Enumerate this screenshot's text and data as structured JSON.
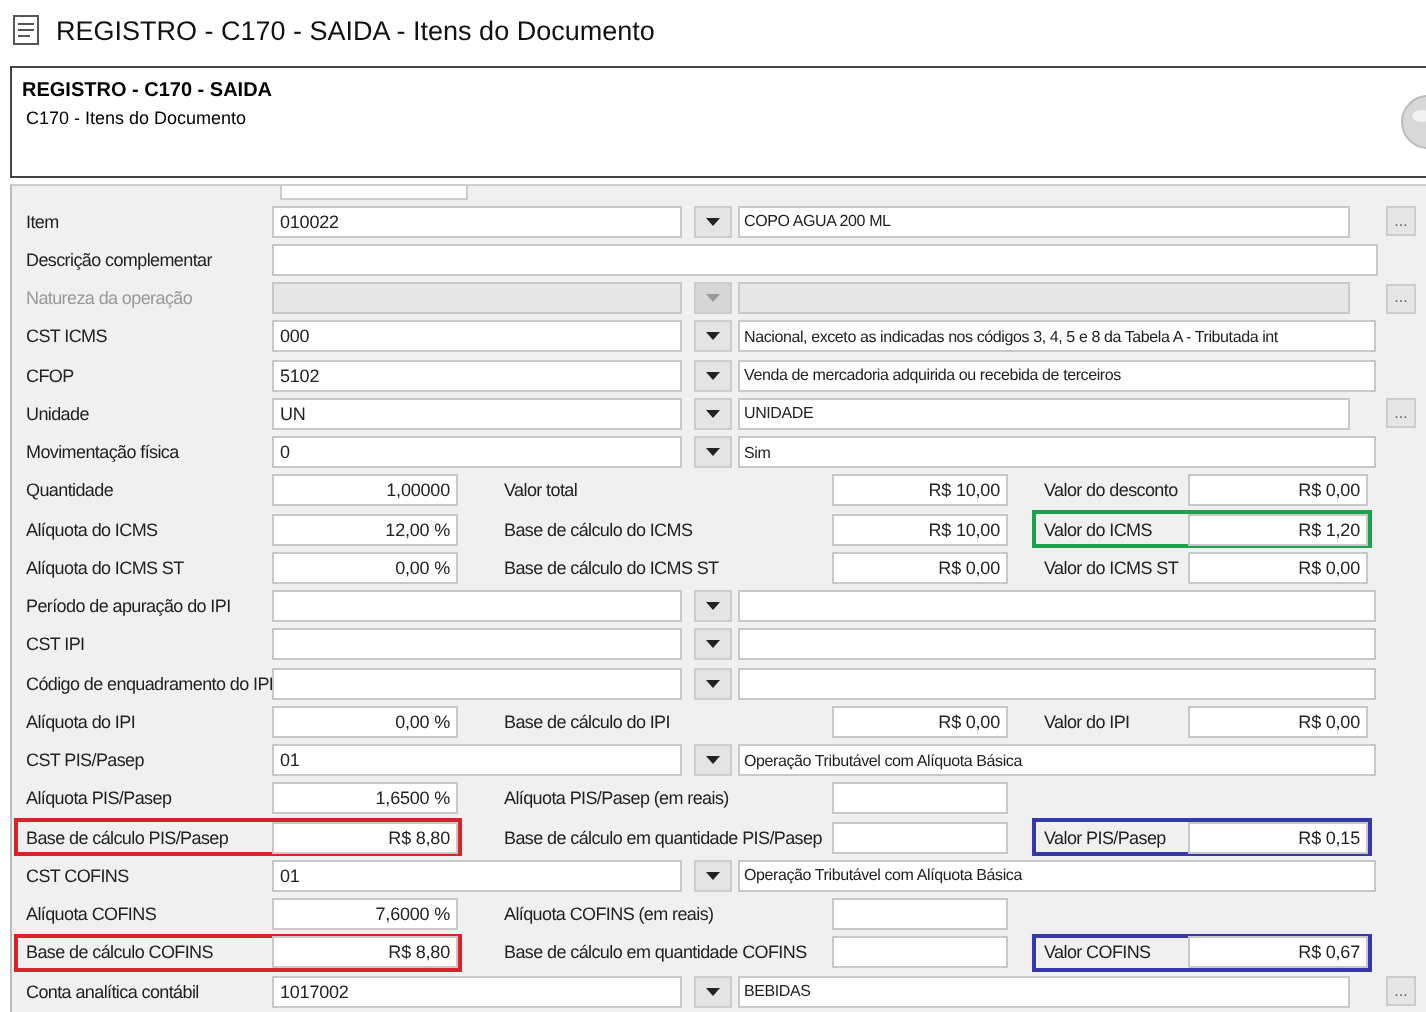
{
  "window": {
    "title": "REGISTRO - C170 - SAIDA - Itens do Documento"
  },
  "header": {
    "title": "REGISTRO - C170 - SAIDA",
    "subtitle": "C170 - Itens do Documento"
  },
  "form": {
    "rows": [
      {
        "kind": "lookup",
        "label": "Item",
        "code": "010022",
        "description": "COPO AGUA 200 ML",
        "more_button": "...",
        "disabled": false
      },
      {
        "kind": "text",
        "label": "Descrição complementar",
        "disabled": false
      },
      {
        "kind": "lookup",
        "label": "Natureza da operação",
        "more_button": "...",
        "disabled": true
      },
      {
        "kind": "lookup",
        "label": "CST ICMS",
        "code": "000",
        "description": "Nacional, exceto as indicadas nos códigos 3, 4, 5 e 8 da Tabela A - Tributada int",
        "disabled": false
      },
      {
        "kind": "lookup",
        "label": "CFOP",
        "code": "5102",
        "description": "Venda de mercadoria adquirida ou recebida de terceiros",
        "disabled": false
      },
      {
        "kind": "lookup",
        "label": "Unidade",
        "code": "UN",
        "description": "UNIDADE",
        "more_button": "...",
        "disabled": false
      },
      {
        "kind": "lookup",
        "label": "Movimentação física",
        "code": "0",
        "description": "Sim",
        "disabled": false
      },
      {
        "kind": "numbers",
        "cells": [
          {
            "label": "Quantidade",
            "value": "1,00000"
          },
          {
            "label": "Valor total",
            "value": "R$ 10,00"
          },
          {
            "label": "Valor do desconto",
            "value": "R$ 0,00"
          }
        ]
      },
      {
        "kind": "numbers",
        "cells": [
          {
            "label": "Alíquota do ICMS",
            "value": "12,00 %"
          },
          {
            "label": "Base de cálculo do ICMS",
            "value": "R$ 10,00"
          },
          {
            "label": "Valor do ICMS",
            "value": "R$ 1,20",
            "color": "#1fa04a"
          }
        ]
      },
      {
        "kind": "numbers",
        "cells": [
          {
            "label": "Alíquota do ICMS ST",
            "value": "0,00 %"
          },
          {
            "label": "Base de cálculo do ICMS ST",
            "value": "R$ 0,00"
          },
          {
            "label": "Valor do ICMS ST",
            "value": "R$ 0,00"
          }
        ]
      },
      {
        "kind": "lookup",
        "label": "Período de apuração do IPI",
        "disabled": false
      },
      {
        "kind": "lookup",
        "label": "CST IPI",
        "disabled": false
      },
      {
        "kind": "lookup",
        "label": "Código de enquadramento do IPI",
        "disabled": false
      },
      {
        "kind": "numbers",
        "cells": [
          {
            "label": "Alíquota do IPI",
            "value": "0,00 %"
          },
          {
            "label": "Base de cálculo do IPI",
            "value": "R$ 0,00"
          },
          {
            "label": "Valor do IPI",
            "value": "R$ 0,00"
          }
        ]
      },
      {
        "kind": "lookup",
        "label": "CST PIS/Pasep",
        "code": "01",
        "description": "Operação Tributável com Alíquota Básica",
        "disabled": false
      },
      {
        "kind": "numbers",
        "cells": [
          {
            "label": "Alíquota PIS/Pasep",
            "value": "1,6500 %"
          },
          {
            "label": "Alíquota PIS/Pasep (em reais)"
          }
        ]
      },
      {
        "kind": "numbers",
        "cells": [
          {
            "label": "Base de cálculo PIS/Pasep",
            "value": "R$ 8,80",
            "color": "#d8232a"
          },
          {
            "label": "Base de cálculo em quantidade PIS/Pasep"
          },
          {
            "label": "Valor PIS/Pasep",
            "value": "R$ 0,15",
            "color": "#3538a8"
          }
        ]
      },
      {
        "kind": "lookup",
        "label": "CST COFINS",
        "code": "01",
        "description": "Operação Tributável com Alíquota Básica",
        "disabled": false
      },
      {
        "kind": "numbers",
        "cells": [
          {
            "label": "Alíquota COFINS",
            "value": "7,6000 %"
          },
          {
            "label": "Alíquota COFINS (em reais)"
          }
        ]
      },
      {
        "kind": "numbers",
        "cells": [
          {
            "label": "Base de cálculo COFINS",
            "value": "R$ 8,80",
            "color": "#d8232a"
          },
          {
            "label": "Base de cálculo em quantidade COFINS"
          },
          {
            "label": "Valor COFINS",
            "value": "R$ 0,67",
            "color": "#3538a8"
          }
        ]
      },
      {
        "kind": "lookup",
        "label": "Conta analítica contábil",
        "code": "1017002",
        "description": "BEBIDAS",
        "more_button": "...",
        "disabled": false
      }
    ]
  }
}
